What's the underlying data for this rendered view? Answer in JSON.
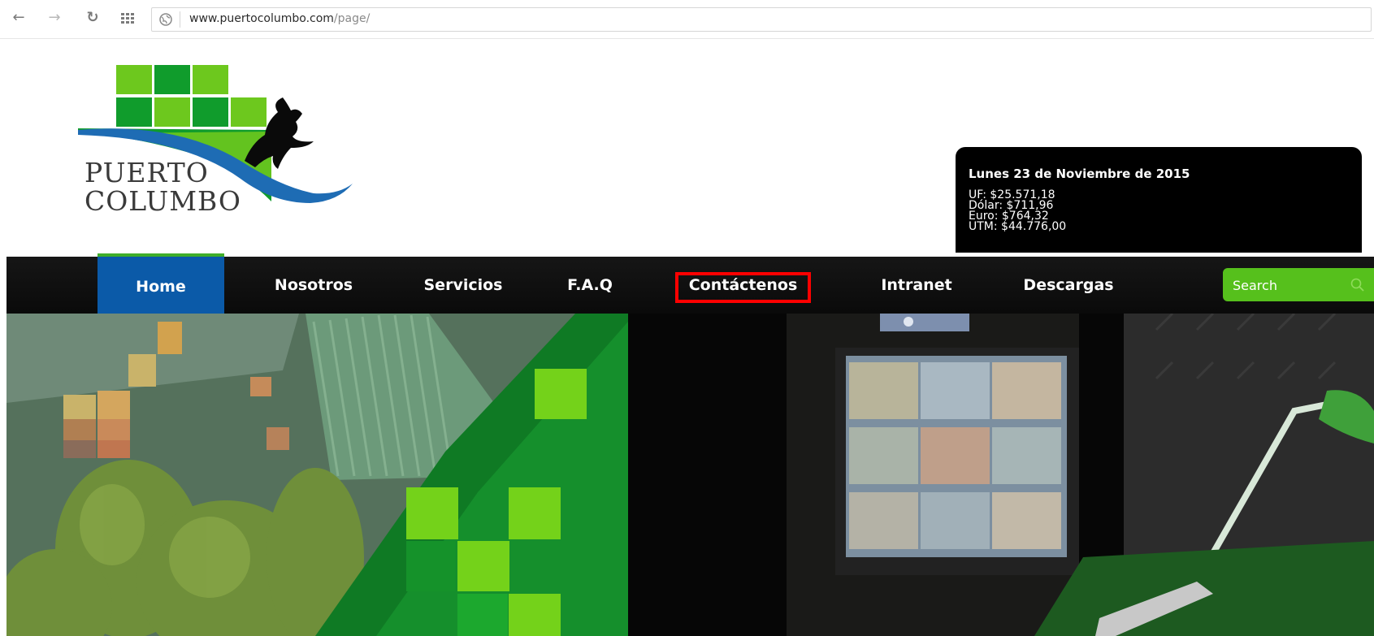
{
  "browser": {
    "url_domain": "www.puertocolumbo.com",
    "url_path": "/page/",
    "back_icon": "arrow-left-icon",
    "forward_icon": "arrow-right-icon",
    "reload_icon": "reload-icon",
    "apps_icon": "apps-grid-icon"
  },
  "logo": {
    "line1": "PUERTO",
    "line2": "COLUMBO",
    "colors": {
      "green_light": "#6dc81e",
      "green_dark": "#109c2c",
      "wave_blue": "#1e6cb4"
    }
  },
  "info": {
    "date": "Lunes 23 de Noviembre de 2015",
    "uf": "UF: $25.571,18",
    "dolar": "Dólar: $711,96",
    "euro": "Euro: $764,32",
    "utm": "UTM: $44.776,00"
  },
  "nav": {
    "items": [
      {
        "label": "Home"
      },
      {
        "label": "Nosotros"
      },
      {
        "label": "Servicios"
      },
      {
        "label": "F.A.Q"
      },
      {
        "label": "Contáctenos"
      },
      {
        "label": "Intranet"
      },
      {
        "label": "Descargas"
      }
    ],
    "active_color": "#0b5aa8",
    "highlight_color": "#ff0000"
  },
  "search": {
    "placeholder": "Search",
    "icon": "search-icon",
    "color": "#56c01c"
  }
}
